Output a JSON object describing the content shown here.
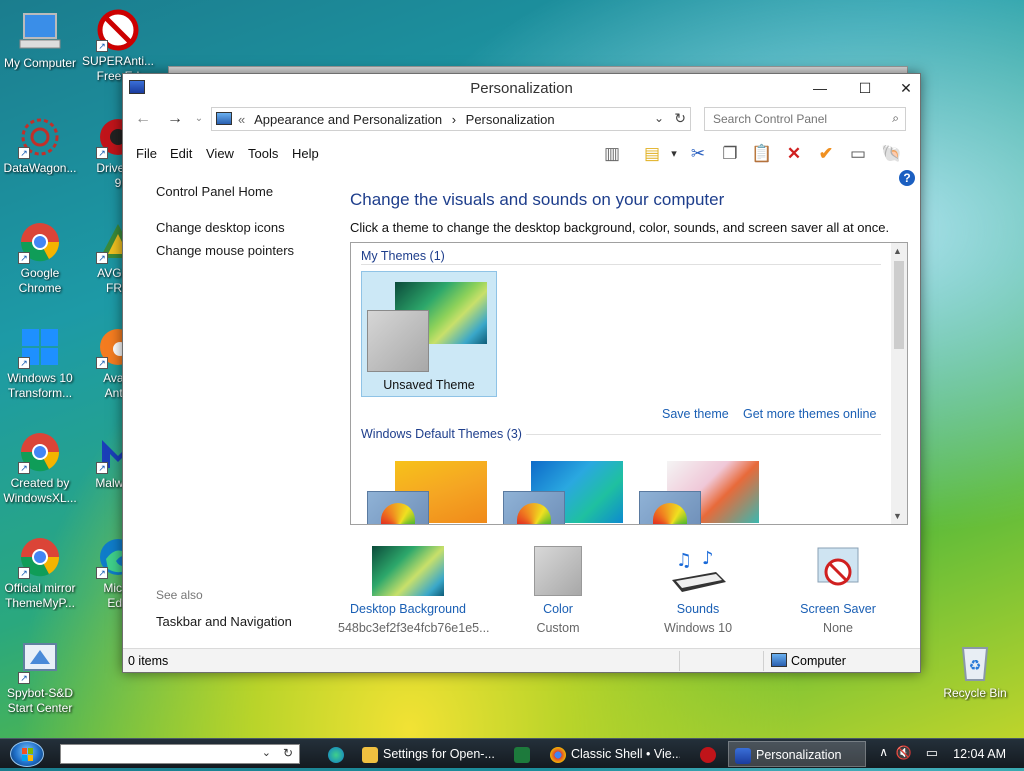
{
  "desktop": {
    "icons": [
      {
        "label1": "My Computer",
        "label2": ""
      },
      {
        "label1": "SUPERAnti...",
        "label2": "Free Ed"
      },
      {
        "label1": "DataWagon...",
        "label2": ""
      },
      {
        "label1": "Driver B",
        "label2": "9"
      },
      {
        "label1": "Google",
        "label2": "Chrome"
      },
      {
        "label1": "AVG An",
        "label2": "FRE"
      },
      {
        "label1": "Windows 10",
        "label2": "Transform..."
      },
      {
        "label1": "Avast",
        "label2": "Antiv"
      },
      {
        "label1": "Created by",
        "label2": "WindowsXL..."
      },
      {
        "label1": "Malware",
        "label2": ""
      },
      {
        "label1": "Official mirror",
        "label2": "ThemeMyP..."
      },
      {
        "label1": "Micro",
        "label2": "Edg"
      },
      {
        "label1": "Spybot-S&D",
        "label2": "Start Center"
      },
      {
        "label1": "Recycle Bin",
        "label2": ""
      }
    ]
  },
  "window": {
    "title": "Personalization",
    "controls": {
      "minimize": "—",
      "maximize": "☐",
      "close": "✕"
    },
    "address": {
      "chevrons": "«",
      "crumb1": "Appearance and Personalization",
      "sep": "›",
      "crumb2": "Personalization"
    },
    "search": {
      "placeholder": "Search Control Panel"
    },
    "menu": [
      "File",
      "Edit",
      "View",
      "Tools",
      "Help"
    ],
    "sidebar": {
      "home": "Control Panel Home",
      "links": [
        "Change desktop icons",
        "Change mouse pointers"
      ],
      "see_also": "See also",
      "see_also_links": [
        "Taskbar and Navigation"
      ]
    },
    "main": {
      "title": "Change the visuals and sounds on your computer",
      "subtitle": "Click a theme to change the desktop background, color, sounds, and screen saver all at once.",
      "my_themes_group": "My Themes (1)",
      "unsaved_theme": "Unsaved Theme",
      "save_theme": "Save theme",
      "get_more": "Get more themes online",
      "default_group": "Windows Default Themes (3)"
    },
    "bottom": [
      {
        "title": "Desktop Background",
        "sub": "548bc3ef2f3e4fcb76e1e5..."
      },
      {
        "title": "Color",
        "sub": "Custom"
      },
      {
        "title": "Sounds",
        "sub": "Windows 10"
      },
      {
        "title": "Screen Saver",
        "sub": "None"
      }
    ],
    "status": {
      "count": "0 items",
      "location": "Computer"
    }
  },
  "taskbar": {
    "tasks": [
      {
        "label": "Settings for Open-..."
      },
      {
        "label": "Classic Shell • Vie..."
      },
      {
        "label": "Personalization"
      }
    ],
    "clock": "12:04 AM"
  },
  "colors": {
    "accent": "#1a5fb4",
    "title_blue": "#1e3e8c",
    "selection": "#cce8f6"
  }
}
